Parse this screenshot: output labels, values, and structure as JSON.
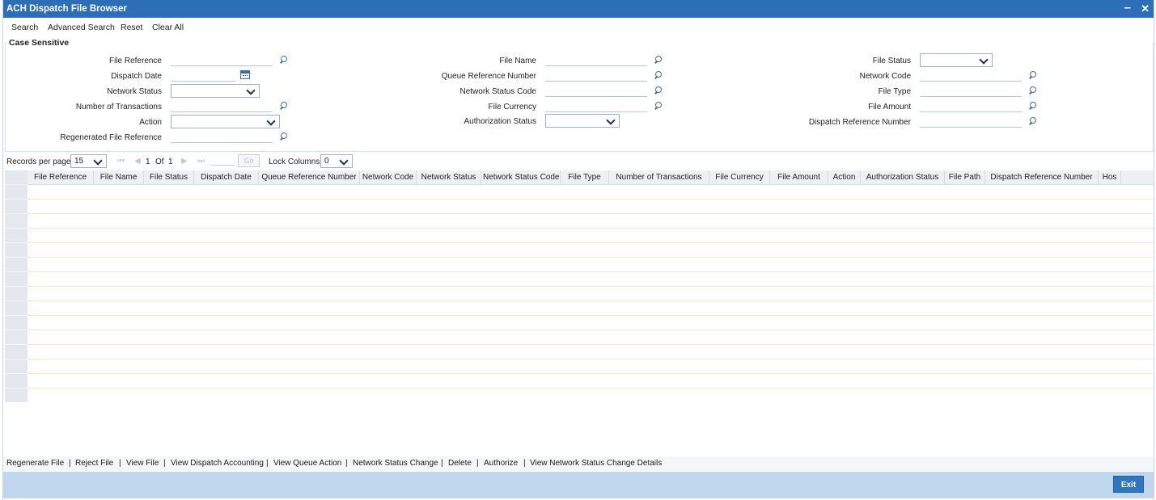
{
  "window": {
    "title": "ACH Dispatch File Browser",
    "minimize": "–",
    "close": "✕"
  },
  "toolbar": {
    "search": "Search",
    "advanced_search": "Advanced Search",
    "reset": "Reset",
    "clear_all": "Clear All"
  },
  "case_sensitive": "Case Sensitive",
  "criteria": {
    "file_reference": "File Reference",
    "dispatch_date": "Dispatch Date",
    "network_status": "Network Status",
    "number_of_transactions": "Number of Transactions",
    "action": "Action",
    "regenerated_file_reference": "Regenerated File Reference",
    "file_name": "File Name",
    "queue_reference_number": "Queue Reference Number",
    "network_status_code": "Network Status Code",
    "file_currency": "File Currency",
    "authorization_status": "Authorization Status",
    "file_status": "File Status",
    "network_code": "Network Code",
    "file_type": "File Type",
    "file_amount": "File Amount",
    "dispatch_reference_number": "Dispatch Reference Number"
  },
  "pager": {
    "records_per_page_label": "Records per page",
    "records_per_page": "15",
    "current_page": "1",
    "of_label": "Of",
    "total_pages": "1",
    "go": "Go",
    "lock_columns_label": "Lock Columns",
    "lock_columns": "0"
  },
  "grid": {
    "columns": [
      "File Reference",
      "File Name",
      "File Status",
      "Dispatch Date",
      "Queue Reference Number",
      "Network Code",
      "Network Status",
      "Network Status Code",
      "File Type",
      "Number of Transactions",
      "File Currency",
      "File Amount",
      "Action",
      "Authorization Status",
      "File Path",
      "Dispatch Reference Number",
      "Hos"
    ],
    "rows": 15
  },
  "actions": {
    "regenerate_file": "Regenerate File",
    "reject_file": "Reject File",
    "view_file": "View File",
    "view_dispatch_accounting": "View Dispatch Accounting",
    "view_queue_action": "View Queue Action",
    "network_status_change": "Network Status Change",
    "delete": "Delete",
    "authorize": "Authorize",
    "view_network_status_change_details": "View Network Status Change Details"
  },
  "footer": {
    "exit": "Exit"
  },
  "colors": {
    "title_bar": "#2c6fb7",
    "footer": "#bfd6ec",
    "exit_button": "#2f76c1",
    "grid_header": "#eef0f3"
  }
}
